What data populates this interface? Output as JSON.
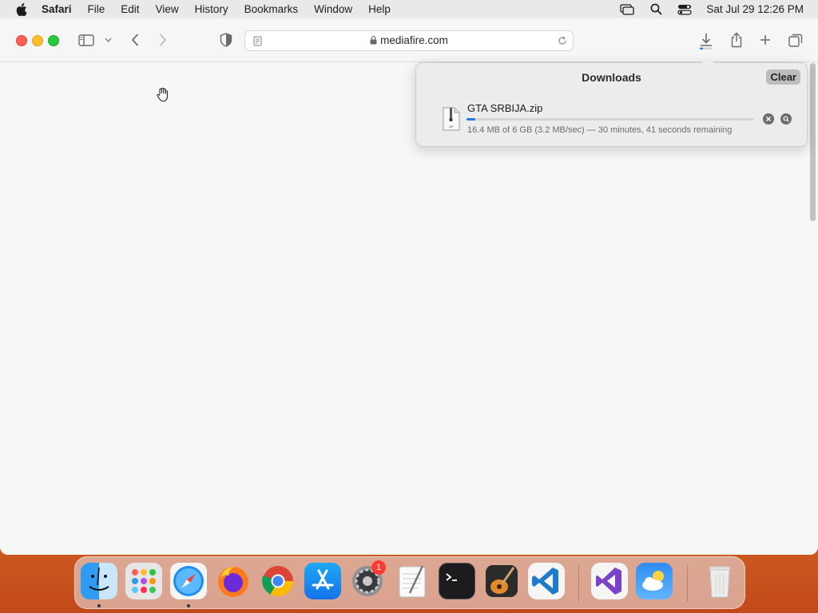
{
  "menubar": {
    "app_name": "Safari",
    "items": [
      "File",
      "Edit",
      "View",
      "History",
      "Bookmarks",
      "Window",
      "Help"
    ],
    "clock": "Sat Jul 29  12:26 PM"
  },
  "address_bar": {
    "url": "mediafire.com"
  },
  "downloads": {
    "title": "Downloads",
    "clear_label": "Clear",
    "file": {
      "name": "GTA SRBIJA.zip",
      "progress": 0.03,
      "status": "16.4 MB of 6 GB (3.2 MB/sec) — 30 minutes, 41 seconds remaining"
    }
  },
  "dock": {
    "items": [
      "Finder",
      "Launchpad",
      "Safari",
      "Firefox",
      "Chrome",
      "App Store",
      "System Preferences",
      "TextEdit",
      "Terminal",
      "GarageBand",
      "Visual Studio Code",
      "Visual Studio",
      "Weather",
      "Trash"
    ],
    "system_prefs_badge": "1"
  },
  "colors": {
    "accent": "#2a76e0",
    "menubar_bg": "#e9e9ea",
    "window_bg": "#f7f7f7"
  }
}
